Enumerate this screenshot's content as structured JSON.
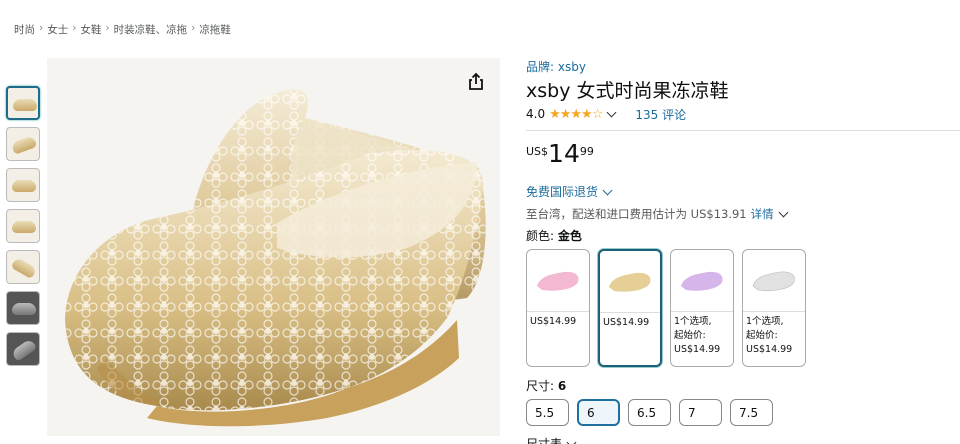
{
  "breadcrumb": [
    "时尚",
    "女士",
    "女鞋",
    "时装凉鞋、凉拖",
    "凉拖鞋"
  ],
  "brand": {
    "label": "品牌:",
    "value": "xsby"
  },
  "product": {
    "title": "xsby 女式时尚果冻凉鞋"
  },
  "rating": {
    "value": "4.0",
    "stars": "★★★★☆",
    "reviews": "135 评论"
  },
  "price": {
    "currency": "US$",
    "whole": "14",
    "fraction": "99"
  },
  "shipping": {
    "label": "免费国际退货",
    "tax_text": "至台湾，配送和进口费用估计为 US$13.91",
    "details": "详情"
  },
  "color": {
    "label": "颜色:",
    "selected": "金色"
  },
  "swatches": [
    {
      "line1": "US$14.99",
      "line2": "",
      "line3": "",
      "tint": "#f3b9d3"
    },
    {
      "line1": "US$14.99",
      "line2": "",
      "line3": "",
      "tint": "#e5cf97"
    },
    {
      "line1": "1个选项,",
      "line2": "起始价:",
      "line3": "US$14.99",
      "tint": "#d6b6ea"
    },
    {
      "line1": "1个选项,",
      "line2": "起始价:",
      "line3": "US$14.99",
      "tint": "#e1e1e1"
    }
  ],
  "size": {
    "label": "尺寸:",
    "selected": "6",
    "options": [
      "5.5",
      "6",
      "6.5",
      "7",
      "7.5"
    ],
    "chart": "尺寸表"
  }
}
